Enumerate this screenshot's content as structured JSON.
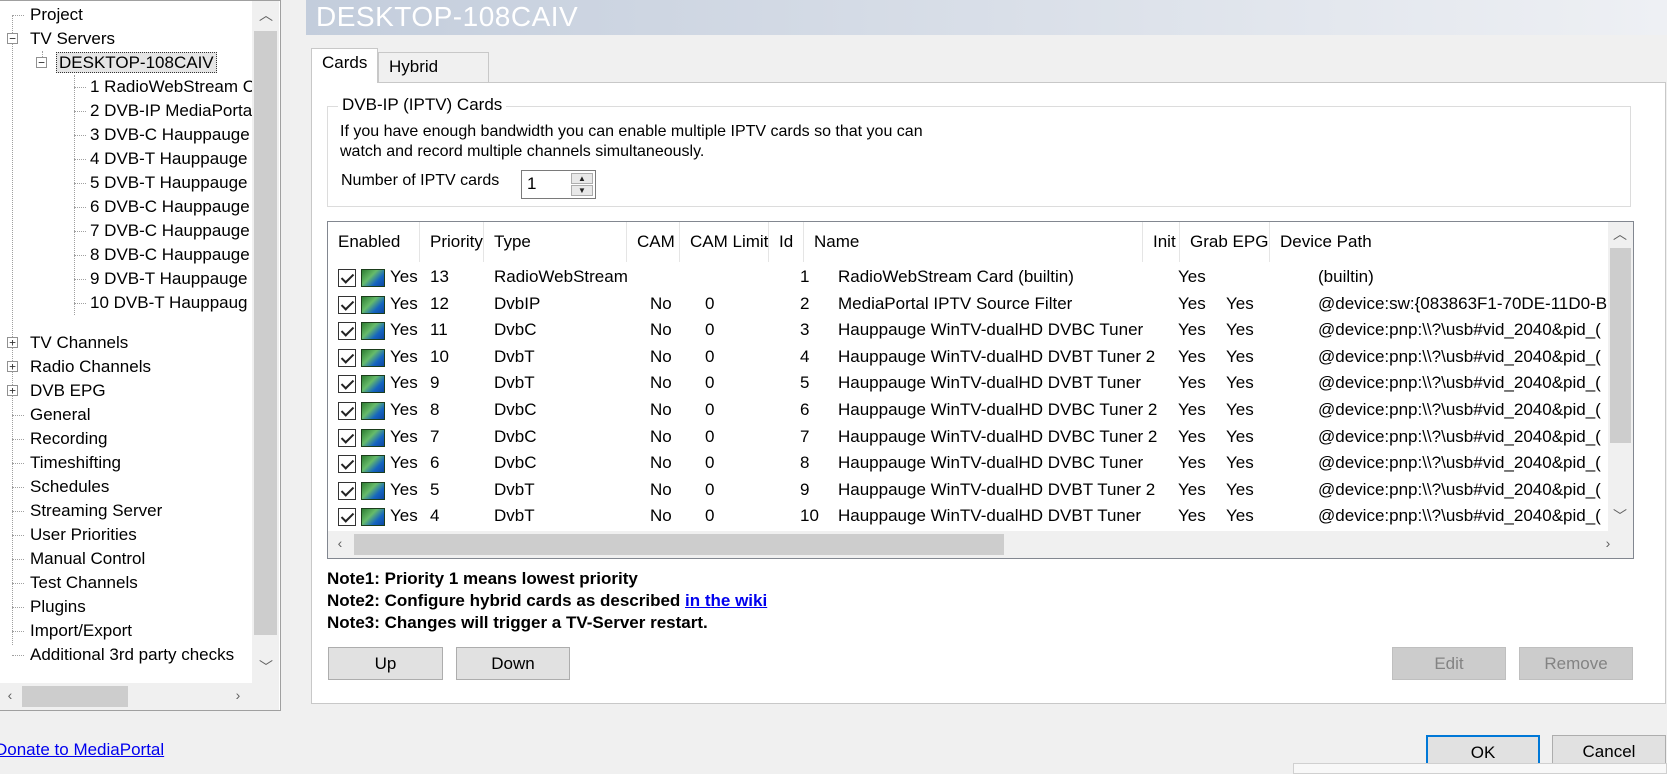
{
  "tree": {
    "items": [
      {
        "label": "Project"
      },
      {
        "label": "TV Servers"
      },
      {
        "label": "DESKTOP-108CAIV"
      },
      {
        "label": "1 RadioWebStream C"
      },
      {
        "label": "2 DVB-IP MediaPorta"
      },
      {
        "label": "3 DVB-C Hauppauge"
      },
      {
        "label": "4 DVB-T Hauppauge"
      },
      {
        "label": "5 DVB-T Hauppauge"
      },
      {
        "label": "6 DVB-C Hauppauge"
      },
      {
        "label": "7 DVB-C Hauppauge"
      },
      {
        "label": "8 DVB-C Hauppauge"
      },
      {
        "label": "9 DVB-T Hauppauge"
      },
      {
        "label": "10 DVB-T Hauppaug"
      },
      {
        "label": "TV Channels"
      },
      {
        "label": "Radio Channels"
      },
      {
        "label": "DVB EPG"
      },
      {
        "label": "General"
      },
      {
        "label": "Recording"
      },
      {
        "label": "Timeshifting"
      },
      {
        "label": "Schedules"
      },
      {
        "label": "Streaming Server"
      },
      {
        "label": "User Priorities"
      },
      {
        "label": "Manual Control"
      },
      {
        "label": "Test Channels"
      },
      {
        "label": "Plugins"
      },
      {
        "label": "Import/Export"
      },
      {
        "label": "Additional 3rd party checks"
      }
    ],
    "selected": "DESKTOP-108CAIV"
  },
  "header": {
    "title": "DESKTOP-108CAIV"
  },
  "tabs": [
    {
      "label": "Cards"
    },
    {
      "label": "Hybrid cards"
    }
  ],
  "iptv": {
    "group_title": "DVB-IP (IPTV) Cards",
    "description_line1": "If you have enough bandwidth you can enable multiple IPTV cards so that you can",
    "description_line2": "watch and record multiple channels simultaneously.",
    "count_label": "Number of IPTV cards",
    "count_value": "1"
  },
  "table": {
    "columns": [
      "Enabled",
      "Priority",
      "Type",
      "CAM",
      "CAM Limit",
      "Id",
      "Name",
      "Init",
      "Grab EPG",
      "Device Path"
    ],
    "rows": [
      {
        "enabled": "Yes",
        "priority": "13",
        "type": "RadioWebStream",
        "cam": "",
        "cam_limit": "",
        "id": "1",
        "name": "RadioWebStream Card (builtin)",
        "init": "Yes",
        "grab_epg": "",
        "path": "(builtin)"
      },
      {
        "enabled": "Yes",
        "priority": "12",
        "type": "DvbIP",
        "cam": "No",
        "cam_limit": "0",
        "id": "2",
        "name": "MediaPortal IPTV Source Filter",
        "init": "Yes",
        "grab_epg": "Yes",
        "path": "@device:sw:{083863F1-70DE-11D0-B"
      },
      {
        "enabled": "Yes",
        "priority": "11",
        "type": "DvbC",
        "cam": "No",
        "cam_limit": "0",
        "id": "3",
        "name": "Hauppauge WinTV-dualHD DVBC Tuner",
        "init": "Yes",
        "grab_epg": "Yes",
        "path": "@device:pnp:\\\\?\\usb#vid_2040&pid_("
      },
      {
        "enabled": "Yes",
        "priority": "10",
        "type": "DvbT",
        "cam": "No",
        "cam_limit": "0",
        "id": "4",
        "name": "Hauppauge WinTV-dualHD DVBT Tuner 2",
        "init": "Yes",
        "grab_epg": "Yes",
        "path": "@device:pnp:\\\\?\\usb#vid_2040&pid_("
      },
      {
        "enabled": "Yes",
        "priority": "9",
        "type": "DvbT",
        "cam": "No",
        "cam_limit": "0",
        "id": "5",
        "name": "Hauppauge WinTV-dualHD DVBT Tuner",
        "init": "Yes",
        "grab_epg": "Yes",
        "path": "@device:pnp:\\\\?\\usb#vid_2040&pid_("
      },
      {
        "enabled": "Yes",
        "priority": "8",
        "type": "DvbC",
        "cam": "No",
        "cam_limit": "0",
        "id": "6",
        "name": "Hauppauge WinTV-dualHD DVBC Tuner 2",
        "init": "Yes",
        "grab_epg": "Yes",
        "path": "@device:pnp:\\\\?\\usb#vid_2040&pid_("
      },
      {
        "enabled": "Yes",
        "priority": "7",
        "type": "DvbC",
        "cam": "No",
        "cam_limit": "0",
        "id": "7",
        "name": "Hauppauge WinTV-dualHD DVBC Tuner 2",
        "init": "Yes",
        "grab_epg": "Yes",
        "path": "@device:pnp:\\\\?\\usb#vid_2040&pid_("
      },
      {
        "enabled": "Yes",
        "priority": "6",
        "type": "DvbC",
        "cam": "No",
        "cam_limit": "0",
        "id": "8",
        "name": "Hauppauge WinTV-dualHD DVBC Tuner",
        "init": "Yes",
        "grab_epg": "Yes",
        "path": "@device:pnp:\\\\?\\usb#vid_2040&pid_("
      },
      {
        "enabled": "Yes",
        "priority": "5",
        "type": "DvbT",
        "cam": "No",
        "cam_limit": "0",
        "id": "9",
        "name": "Hauppauge WinTV-dualHD DVBT Tuner 2",
        "init": "Yes",
        "grab_epg": "Yes",
        "path": "@device:pnp:\\\\?\\usb#vid_2040&pid_("
      },
      {
        "enabled": "Yes",
        "priority": "4",
        "type": "DvbT",
        "cam": "No",
        "cam_limit": "0",
        "id": "10",
        "name": "Hauppauge WinTV-dualHD DVBT Tuner",
        "init": "Yes",
        "grab_epg": "Yes",
        "path": "@device:pnp:\\\\?\\usb#vid_2040&pid_("
      }
    ]
  },
  "notes": {
    "note1": "Note1: Priority 1 means lowest priority",
    "note2": "Note2: Configure hybrid cards as described ",
    "note2_link": "in the wiki",
    "note3": "Note3: Changes will trigger a TV-Server restart."
  },
  "buttons": {
    "up": "Up",
    "down": "Down",
    "edit": "Edit",
    "remove": "Remove",
    "ok": "OK",
    "cancel": "Cancel"
  },
  "footer": {
    "donate": "Donate to MediaPortal"
  },
  "colors": {
    "link": "#0000ee",
    "accent": "#0078d7",
    "header_gradient_start": "#c3cddc"
  }
}
